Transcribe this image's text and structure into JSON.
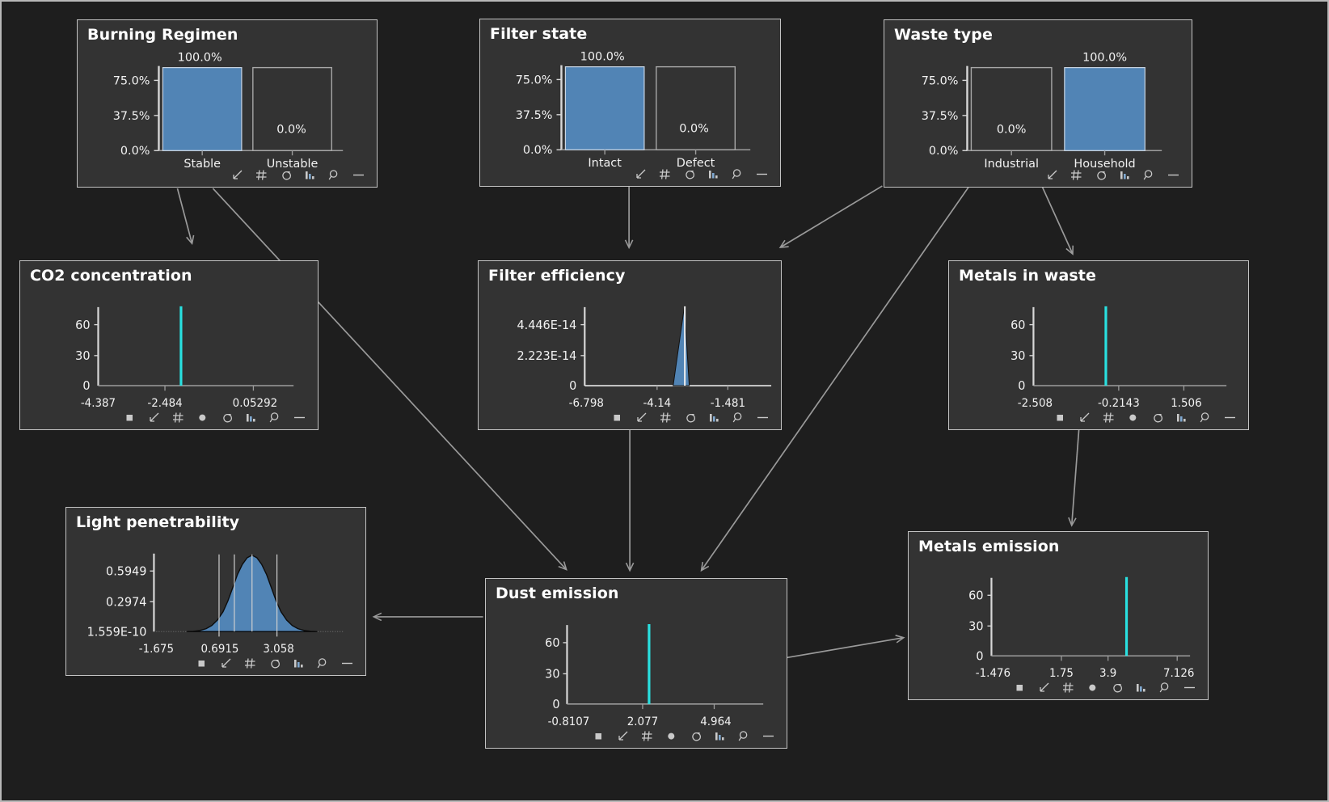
{
  "theme": {
    "background": "#1e1e1e",
    "node_fill": "#333333",
    "node_border": "#c3c3c3",
    "bar_blue": "#5184b5",
    "spike_cyan": "#29e0e0",
    "edge_gray": "#9a9a9a",
    "text": "#f2f2f2"
  },
  "toolbar_icons_bar": [
    "arrow-down-left-icon",
    "grid-icon",
    "sigma-icon",
    "bar-chart-icon",
    "magnifier-icon",
    "minus-icon"
  ],
  "toolbar_icons_dist": [
    "square-icon",
    "arrow-down-left-icon",
    "grid-icon",
    "dot-icon",
    "sigma-icon",
    "bar-chart-icon",
    "magnifier-icon",
    "minus-icon"
  ],
  "nodes": [
    {
      "id": "burning-regimen",
      "title": "Burning Regimen",
      "chart_data": {
        "type": "bar",
        "title": "Burning Regimen",
        "categories": [
          "Stable",
          "Unstable"
        ],
        "values": [
          100.0,
          0.0
        ],
        "value_labels": [
          "100.0%",
          "0.0%"
        ],
        "ytick_labels": [
          "0.0%",
          "37.5%",
          "75.0%"
        ],
        "yticks": [
          0,
          37.5,
          75
        ],
        "ylim": [
          0,
          100
        ],
        "xlabel": "",
        "ylabel": "",
        "grid": false,
        "legend": false
      }
    },
    {
      "id": "filter-state",
      "title": "Filter state",
      "chart_data": {
        "type": "bar",
        "title": "Filter state",
        "categories": [
          "Intact",
          "Defect"
        ],
        "values": [
          100.0,
          0.0
        ],
        "value_labels": [
          "100.0%",
          "0.0%"
        ],
        "ytick_labels": [
          "0.0%",
          "37.5%",
          "75.0%"
        ],
        "yticks": [
          0,
          37.5,
          75
        ],
        "ylim": [
          0,
          100
        ],
        "xlabel": "",
        "ylabel": "",
        "grid": false,
        "legend": false
      }
    },
    {
      "id": "waste-type",
      "title": "Waste type",
      "chart_data": {
        "type": "bar",
        "title": "Waste type",
        "categories": [
          "Industrial",
          "Household"
        ],
        "values": [
          0.0,
          100.0
        ],
        "value_labels": [
          "0.0%",
          "100.0%"
        ],
        "ytick_labels": [
          "0.0%",
          "37.5%",
          "75.0%"
        ],
        "yticks": [
          0,
          37.5,
          75
        ],
        "ylim": [
          0,
          100
        ],
        "xlabel": "",
        "ylabel": "",
        "grid": false,
        "legend": false
      }
    },
    {
      "id": "co2-concentration",
      "title": "CO2 concentration",
      "chart_data": {
        "type": "bar",
        "title": "CO2 concentration",
        "shape": "spike",
        "xtick_labels": [
          "-4.387",
          "-2.484",
          "0.05292"
        ],
        "xticks": [
          -4.387,
          -2.484,
          0.05292
        ],
        "ytick_labels": [
          "0",
          "30",
          "60"
        ],
        "yticks": [
          0,
          30,
          60
        ],
        "ylim": [
          0,
          80
        ],
        "xlim": [
          -4.387,
          1.0
        ],
        "spike_x": -2.21,
        "spike_height": 76,
        "xlabel": "",
        "ylabel": "",
        "grid": false,
        "legend": false
      }
    },
    {
      "id": "filter-efficiency",
      "title": "Filter efficiency",
      "chart_data": {
        "type": "area",
        "title": "Filter efficiency",
        "shape": "narrow-peak",
        "xtick_labels": [
          "-6.798",
          "-4.14",
          "-1.481"
        ],
        "xticks": [
          -6.798,
          -4.14,
          -1.481
        ],
        "ytick_labels": [
          "0",
          "2.223E-14",
          "4.446E-14"
        ],
        "yticks": [
          0,
          2.223e-14,
          4.446e-14
        ],
        "ylim": [
          0,
          5.2e-14
        ],
        "xlim": [
          -6.798,
          0.2
        ],
        "peak_x": -3.2,
        "peak_y": 5e-14,
        "xlabel": "",
        "ylabel": "",
        "grid": false,
        "legend": false
      }
    },
    {
      "id": "metals-in-waste",
      "title": "Metals in waste",
      "chart_data": {
        "type": "bar",
        "title": "Metals in waste",
        "shape": "spike",
        "xtick_labels": [
          "-2.508",
          "-0.2143",
          "1.506"
        ],
        "xticks": [
          -2.508,
          -0.2143,
          1.506
        ],
        "ytick_labels": [
          "0",
          "30",
          "60"
        ],
        "yticks": [
          0,
          30,
          60
        ],
        "ylim": [
          0,
          80
        ],
        "xlim": [
          -2.508,
          2.3
        ],
        "spike_x": -0.42,
        "spike_height": 76,
        "xlabel": "",
        "ylabel": "",
        "grid": false,
        "legend": false
      }
    },
    {
      "id": "light-penetrability",
      "title": "Light penetrability",
      "chart_data": {
        "type": "area",
        "title": "Light penetrability",
        "shape": "bell",
        "xtick_labels": [
          "-1.675",
          "0.6915",
          "3.058"
        ],
        "xticks": [
          -1.675,
          0.6915,
          3.058
        ],
        "ytick_labels": [
          "1.559E-10",
          "0.2974",
          "0.5949"
        ],
        "yticks": [
          1.559e-10,
          0.2974,
          0.5949
        ],
        "ylim": [
          0,
          0.72
        ],
        "xlim": [
          -1.675,
          4.4
        ],
        "mean": 1.55,
        "sigma": 0.67,
        "peak_y": 0.6,
        "quantile_lines": [
          0.69,
          1.18,
          1.62,
          2.22
        ],
        "xlabel": "",
        "ylabel": "",
        "grid": false,
        "legend": false
      }
    },
    {
      "id": "dust-emission",
      "title": "Dust emission",
      "chart_data": {
        "type": "bar",
        "title": "Dust emission",
        "shape": "spike",
        "xtick_labels": [
          "-0.8107",
          "2.077",
          "4.964"
        ],
        "xticks": [
          -0.8107,
          2.077,
          4.964
        ],
        "ytick_labels": [
          "0",
          "30",
          "60"
        ],
        "yticks": [
          0,
          30,
          60
        ],
        "ylim": [
          0,
          80
        ],
        "xlim": [
          -0.8107,
          6.6
        ],
        "spike_x": 2.3,
        "spike_height": 76,
        "xlabel": "",
        "ylabel": "",
        "grid": false,
        "legend": false
      }
    },
    {
      "id": "metals-emission",
      "title": "Metals emission",
      "chart_data": {
        "type": "bar",
        "title": "Metals emission",
        "shape": "spike",
        "xtick_labels": [
          "-1.476",
          "1.75",
          "3.9",
          "7.126"
        ],
        "xticks": [
          -1.476,
          1.75,
          3.9,
          7.126
        ],
        "ytick_labels": [
          "0",
          "30",
          "60"
        ],
        "yticks": [
          0,
          30,
          60
        ],
        "ylim": [
          0,
          80
        ],
        "xlim": [
          -1.476,
          8.8
        ],
        "spike_x": 4.75,
        "spike_height": 76,
        "xlabel": "",
        "ylabel": "",
        "grid": false,
        "legend": false
      }
    }
  ],
  "edges": [
    {
      "from": "burning-regimen",
      "to": "co2-concentration"
    },
    {
      "from": "burning-regimen",
      "to": "dust-emission"
    },
    {
      "from": "filter-state",
      "to": "filter-efficiency"
    },
    {
      "from": "filter-efficiency",
      "to": "dust-emission"
    },
    {
      "from": "waste-type",
      "to": "filter-efficiency"
    },
    {
      "from": "waste-type",
      "to": "metals-in-waste"
    },
    {
      "from": "waste-type",
      "to": "dust-emission"
    },
    {
      "from": "metals-in-waste",
      "to": "metals-emission"
    },
    {
      "from": "dust-emission",
      "to": "light-penetrability"
    },
    {
      "from": "dust-emission",
      "to": "metals-emission"
    }
  ]
}
